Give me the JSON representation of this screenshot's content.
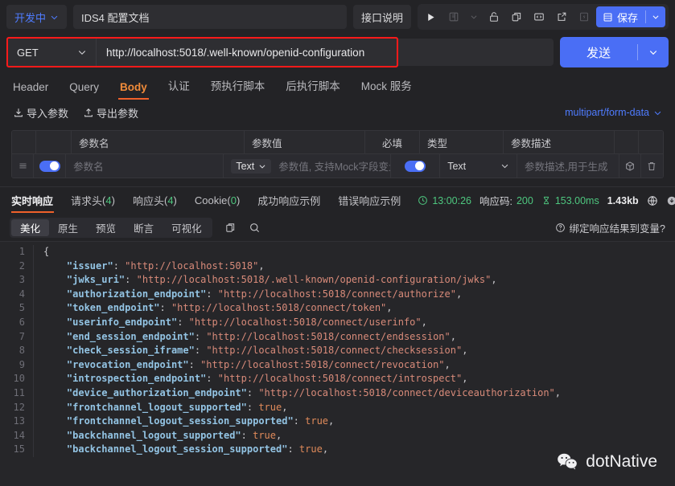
{
  "topbar": {
    "status_label": "开发中",
    "doc_title": "IDS4 配置文档",
    "api_desc_label": "接口说明",
    "icons": [
      "run-icon",
      "doc-icon",
      "chevron-down-icon",
      "unlock-icon",
      "copy-icon",
      "code-icon",
      "share-icon",
      "flash-icon"
    ],
    "save_label": "保存"
  },
  "urlbar": {
    "method": "GET",
    "url": "http://localhost:5018/.well-known/openid-configuration",
    "send_label": "发送",
    "highlight_color": "#ff1a1a"
  },
  "request_tabs": [
    {
      "label": "Header",
      "active": false
    },
    {
      "label": "Query",
      "active": false
    },
    {
      "label": "Body",
      "active": true
    },
    {
      "label": "认证",
      "active": false
    },
    {
      "label": "预执行脚本",
      "active": false
    },
    {
      "label": "后执行脚本",
      "active": false
    },
    {
      "label": "Mock 服务",
      "active": false
    }
  ],
  "params_toolbar": {
    "import_label": "导入参数",
    "export_label": "导出参数",
    "content_type": "multipart/form-data"
  },
  "params_table": {
    "headers": [
      "",
      "",
      "参数名",
      "参数值",
      "必填",
      "类型",
      "参数描述",
      "",
      ""
    ],
    "rows": [
      {
        "enabled": true,
        "name_placeholder": "参数名",
        "value_type": "Text",
        "value_placeholder": "参数值, 支持Mock字段变量",
        "required": true,
        "type": "Text",
        "desc_placeholder": "参数描述,用于生成"
      }
    ]
  },
  "response_tabs": [
    {
      "label": "实时响应",
      "count": null,
      "active": true
    },
    {
      "label": "请求头",
      "count": "4",
      "active": false
    },
    {
      "label": "响应头",
      "count": "4",
      "active": false
    },
    {
      "label": "Cookie",
      "count": "0",
      "active": false
    },
    {
      "label": "成功响应示例",
      "count": null,
      "active": false
    },
    {
      "label": "错误响应示例",
      "count": null,
      "active": false
    }
  ],
  "response_meta": {
    "time": "13:00:26",
    "status_code_label": "响应码:",
    "status_code": "200",
    "duration": "153.00ms",
    "size": "1.43kb"
  },
  "view_tabs": [
    {
      "label": "美化",
      "active": true
    },
    {
      "label": "原生",
      "active": false
    },
    {
      "label": "预览",
      "active": false
    },
    {
      "label": "断言",
      "active": false
    },
    {
      "label": "可视化",
      "active": false
    }
  ],
  "view_actions": {
    "copy_icon": "copy-icon",
    "search_icon": "search-icon",
    "bind_label": "绑定响应结果到变量?"
  },
  "code": {
    "lines": [
      [
        {
          "t": "{",
          "c": "p"
        }
      ],
      [
        {
          "t": "    ",
          "c": "p"
        },
        {
          "t": "\"issuer\"",
          "c": "k"
        },
        {
          "t": ": ",
          "c": "p"
        },
        {
          "t": "\"http://localhost:5018\"",
          "c": "s"
        },
        {
          "t": ",",
          "c": "p"
        }
      ],
      [
        {
          "t": "    ",
          "c": "p"
        },
        {
          "t": "\"jwks_uri\"",
          "c": "k"
        },
        {
          "t": ": ",
          "c": "p"
        },
        {
          "t": "\"http://localhost:5018/.well-known/openid-configuration/jwks\"",
          "c": "s"
        },
        {
          "t": ",",
          "c": "p"
        }
      ],
      [
        {
          "t": "    ",
          "c": "p"
        },
        {
          "t": "\"authorization_endpoint\"",
          "c": "k"
        },
        {
          "t": ": ",
          "c": "p"
        },
        {
          "t": "\"http://localhost:5018/connect/authorize\"",
          "c": "s"
        },
        {
          "t": ",",
          "c": "p"
        }
      ],
      [
        {
          "t": "    ",
          "c": "p"
        },
        {
          "t": "\"token_endpoint\"",
          "c": "k"
        },
        {
          "t": ": ",
          "c": "p"
        },
        {
          "t": "\"http://localhost:5018/connect/token\"",
          "c": "s"
        },
        {
          "t": ",",
          "c": "p"
        }
      ],
      [
        {
          "t": "    ",
          "c": "p"
        },
        {
          "t": "\"userinfo_endpoint\"",
          "c": "k"
        },
        {
          "t": ": ",
          "c": "p"
        },
        {
          "t": "\"http://localhost:5018/connect/userinfo\"",
          "c": "s"
        },
        {
          "t": ",",
          "c": "p"
        }
      ],
      [
        {
          "t": "    ",
          "c": "p"
        },
        {
          "t": "\"end_session_endpoint\"",
          "c": "k"
        },
        {
          "t": ": ",
          "c": "p"
        },
        {
          "t": "\"http://localhost:5018/connect/endsession\"",
          "c": "s"
        },
        {
          "t": ",",
          "c": "p"
        }
      ],
      [
        {
          "t": "    ",
          "c": "p"
        },
        {
          "t": "\"check_session_iframe\"",
          "c": "k"
        },
        {
          "t": ": ",
          "c": "p"
        },
        {
          "t": "\"http://localhost:5018/connect/checksession\"",
          "c": "s"
        },
        {
          "t": ",",
          "c": "p"
        }
      ],
      [
        {
          "t": "    ",
          "c": "p"
        },
        {
          "t": "\"revocation_endpoint\"",
          "c": "k"
        },
        {
          "t": ": ",
          "c": "p"
        },
        {
          "t": "\"http://localhost:5018/connect/revocation\"",
          "c": "s"
        },
        {
          "t": ",",
          "c": "p"
        }
      ],
      [
        {
          "t": "    ",
          "c": "p"
        },
        {
          "t": "\"introspection_endpoint\"",
          "c": "k"
        },
        {
          "t": ": ",
          "c": "p"
        },
        {
          "t": "\"http://localhost:5018/connect/introspect\"",
          "c": "s"
        },
        {
          "t": ",",
          "c": "p"
        }
      ],
      [
        {
          "t": "    ",
          "c": "p"
        },
        {
          "t": "\"device_authorization_endpoint\"",
          "c": "k"
        },
        {
          "t": ": ",
          "c": "p"
        },
        {
          "t": "\"http://localhost:5018/connect/deviceauthorization\"",
          "c": "s"
        },
        {
          "t": ",",
          "c": "p"
        }
      ],
      [
        {
          "t": "    ",
          "c": "p"
        },
        {
          "t": "\"frontchannel_logout_supported\"",
          "c": "k"
        },
        {
          "t": ": ",
          "c": "p"
        },
        {
          "t": "true",
          "c": "b"
        },
        {
          "t": ",",
          "c": "p"
        }
      ],
      [
        {
          "t": "    ",
          "c": "p"
        },
        {
          "t": "\"frontchannel_logout_session_supported\"",
          "c": "k"
        },
        {
          "t": ": ",
          "c": "p"
        },
        {
          "t": "true",
          "c": "b"
        },
        {
          "t": ",",
          "c": "p"
        }
      ],
      [
        {
          "t": "    ",
          "c": "p"
        },
        {
          "t": "\"backchannel_logout_supported\"",
          "c": "k"
        },
        {
          "t": ": ",
          "c": "p"
        },
        {
          "t": "true",
          "c": "b"
        },
        {
          "t": ",",
          "c": "p"
        }
      ],
      [
        {
          "t": "    ",
          "c": "p"
        },
        {
          "t": "\"backchannel_logout_session_supported\"",
          "c": "k"
        },
        {
          "t": ": ",
          "c": "p"
        },
        {
          "t": "true",
          "c": "b"
        },
        {
          "t": ",",
          "c": "p"
        }
      ]
    ]
  },
  "watermark": {
    "icon": "wechat-icon",
    "text": "dotNative"
  }
}
